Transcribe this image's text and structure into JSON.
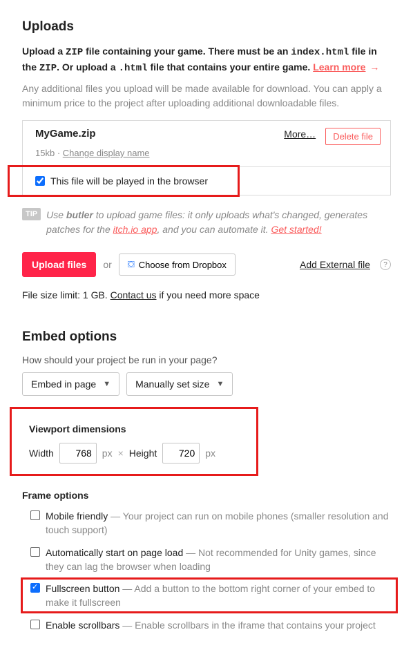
{
  "uploads": {
    "title": "Uploads",
    "intro_pre": "Upload a ",
    "intro_zip": "ZIP",
    "intro_mid1": " file containing your game. There must be an ",
    "intro_index": "index.html",
    "intro_mid2": " file in the ",
    "intro_zip2": "ZIP",
    "intro_post": ". Or upload a ",
    "intro_html": ".html",
    "intro_end": " file that contains your entire game. ",
    "learn_more": "Learn more",
    "additional": "Any additional files you upload will be made available for download. You can apply a minimum price to the project after uploading additional downloadable files.",
    "file": {
      "name": "MyGame.zip",
      "more": "More…",
      "delete": "Delete file",
      "size": "15kb",
      "dot": " · ",
      "change": "Change display name",
      "play_label": "This file will be played in the browser"
    },
    "tip": {
      "badge": "TIP",
      "pre": "Use ",
      "butler": "butler",
      "mid1": " to upload game files: it only uploads what's changed, generates patches for the ",
      "app": "itch.io app",
      "mid2": ", and you can automate it. ",
      "getstarted": "Get started!"
    },
    "upload_btn": "Upload files",
    "or": "or",
    "dropbox": "Choose from Dropbox",
    "external": "Add External file",
    "limit_pre": "File size limit: 1 GB. ",
    "contact": "Contact us",
    "limit_post": " if you need more space"
  },
  "embed": {
    "title": "Embed options",
    "howq": "How should your project be run in your page?",
    "sel1": "Embed in page",
    "sel2": "Manually set size",
    "viewport_title": "Viewport dimensions",
    "width_lbl": "Width",
    "width_val": "768",
    "px": "px",
    "times": "×",
    "height_lbl": "Height",
    "height_val": "720",
    "frame_title": "Frame options",
    "opts": {
      "mobile": "Mobile friendly",
      "mobile_desc": " — Your project can run on mobile phones (smaller resolution and touch support)",
      "auto": "Automatically start on page load",
      "auto_desc": " — Not recommended for Unity games, since they can lag the browser when loading",
      "fs": "Fullscreen button",
      "fs_desc": " — Add a button to the bottom right corner of your embed to make it fullscreen",
      "scroll": "Enable scrollbars",
      "scroll_desc": " — Enable scrollbars in the iframe that contains your project"
    }
  }
}
